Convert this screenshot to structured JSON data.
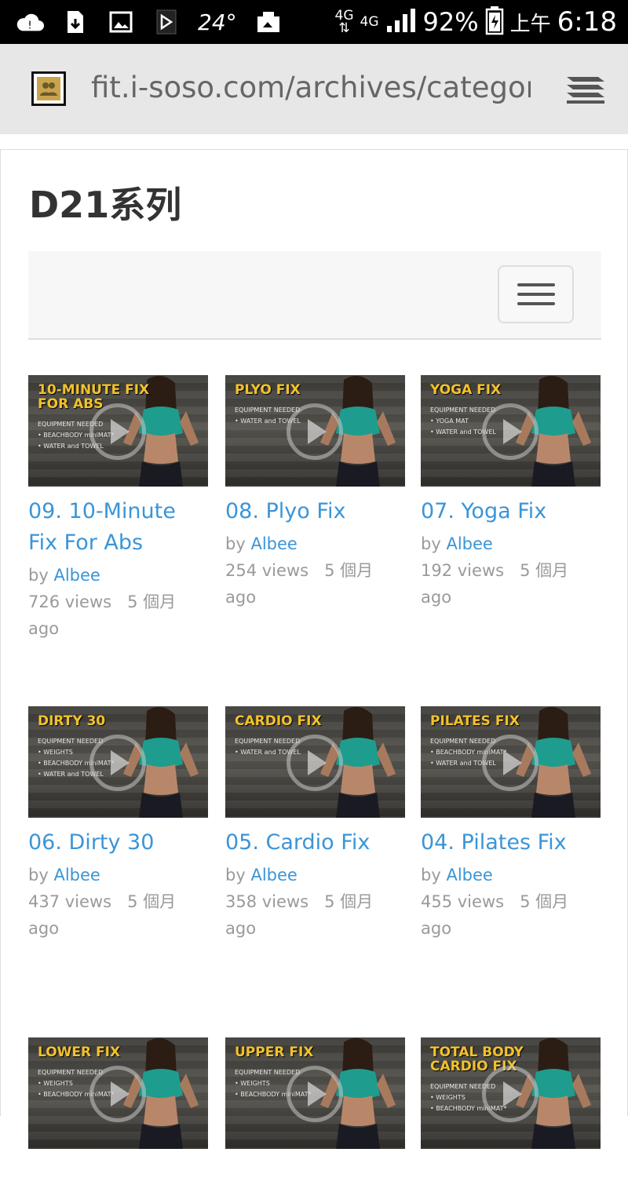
{
  "status_bar": {
    "temperature": "24°",
    "network_top": "4G",
    "network_bottom": "4G",
    "battery_pct": "92%",
    "ampm": "上午",
    "time": "6:18"
  },
  "browser": {
    "url": "fit.i-soso.com/archives/categor"
  },
  "page": {
    "title": "D21系列"
  },
  "cards": [
    {
      "thumb_title": "10-MINUTE FIX FOR ABS",
      "equip_heading": "EQUIPMENT NEEDED",
      "equip": [
        "• BEACHBODY miniMAT*",
        "• WATER and TOWEL"
      ],
      "title": "09. 10-Minute Fix For Abs",
      "by": "by",
      "author": "Albee",
      "views": "726 views",
      "age_a": "5 個月",
      "age_b": "ago"
    },
    {
      "thumb_title": "PLYO FIX",
      "equip_heading": "EQUIPMENT NEEDED",
      "equip": [
        "• WATER and TOWEL"
      ],
      "title": "08. Plyo Fix",
      "by": "by",
      "author": "Albee",
      "views": "254 views",
      "age_a": "5 個月",
      "age_b": "ago"
    },
    {
      "thumb_title": "YOGA FIX",
      "equip_heading": "EQUIPMENT NEEDED",
      "equip": [
        "• YOGA MAT",
        "• WATER and TOWEL"
      ],
      "title": "07. Yoga Fix",
      "by": "by",
      "author": "Albee",
      "views": "192 views",
      "age_a": "5 個月",
      "age_b": "ago"
    },
    {
      "thumb_title": "DIRTY 30",
      "equip_heading": "EQUIPMENT NEEDED",
      "equip": [
        "• WEIGHTS",
        "• BEACHBODY miniMAT*",
        "• WATER and TOWEL"
      ],
      "title": "06. Dirty 30",
      "by": "by",
      "author": "Albee",
      "views": "437 views",
      "age_a": "5 個月",
      "age_b": "ago"
    },
    {
      "thumb_title": "CARDIO FIX",
      "equip_heading": "EQUIPMENT NEEDED",
      "equip": [
        "• WATER and TOWEL"
      ],
      "title": "05. Cardio Fix",
      "by": "by",
      "author": "Albee",
      "views": "358 views",
      "age_a": "5 個月",
      "age_b": "ago"
    },
    {
      "thumb_title": "PILATES FIX",
      "equip_heading": "EQUIPMENT NEEDED",
      "equip": [
        "• BEACHBODY miniMAT*",
        "• WATER and TOWEL"
      ],
      "title": "04. Pilates Fix",
      "by": "by",
      "author": "Albee",
      "views": "455 views",
      "age_a": "5 個月",
      "age_b": "ago"
    },
    {
      "thumb_title": "LOWER FIX",
      "equip_heading": "EQUIPMENT NEEDED",
      "equip": [
        "• WEIGHTS",
        "• BEACHBODY miniMAT*"
      ],
      "title": "",
      "by": "",
      "author": "",
      "views": "",
      "age_a": "",
      "age_b": ""
    },
    {
      "thumb_title": "UPPER FIX",
      "equip_heading": "EQUIPMENT NEEDED",
      "equip": [
        "• WEIGHTS",
        "• BEACHBODY miniMAT*"
      ],
      "title": "",
      "by": "",
      "author": "",
      "views": "",
      "age_a": "",
      "age_b": ""
    },
    {
      "thumb_title": "TOTAL BODY CARDIO FIX",
      "equip_heading": "EQUIPMENT NEEDED",
      "equip": [
        "• WEIGHTS",
        "• BEACHBODY miniMAT*"
      ],
      "title": "",
      "by": "",
      "author": "",
      "views": "",
      "age_a": "",
      "age_b": ""
    }
  ],
  "colors": {
    "link": "#3a95d8",
    "thumb_title": "#f3c22a",
    "meta": "#9a9a9a"
  }
}
